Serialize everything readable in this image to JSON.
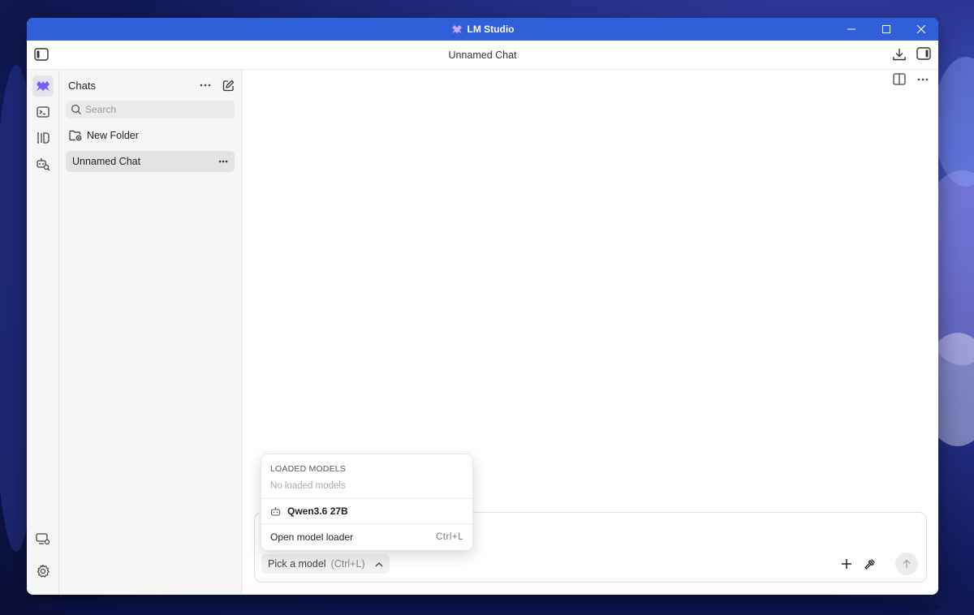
{
  "window": {
    "app_title": "LM Studio",
    "chat_title": "Unnamed Chat"
  },
  "sidebar": {
    "title": "Chats",
    "search_placeholder": "Search",
    "new_folder_label": "New Folder",
    "chats": [
      {
        "label": "Unnamed Chat"
      }
    ]
  },
  "composer": {
    "pick_model_label": "Pick a model",
    "pick_model_shortcut": "(Ctrl+L)"
  },
  "model_menu": {
    "section_label": "LOADED MODELS",
    "empty_text": "No loaded models",
    "models": [
      {
        "name": "Qwen3.6 27B"
      }
    ],
    "loader_label": "Open model loader",
    "loader_shortcut": "Ctrl+L"
  },
  "colors": {
    "titlebar": "#2f5fd9",
    "accent": "#7b5cf0"
  }
}
